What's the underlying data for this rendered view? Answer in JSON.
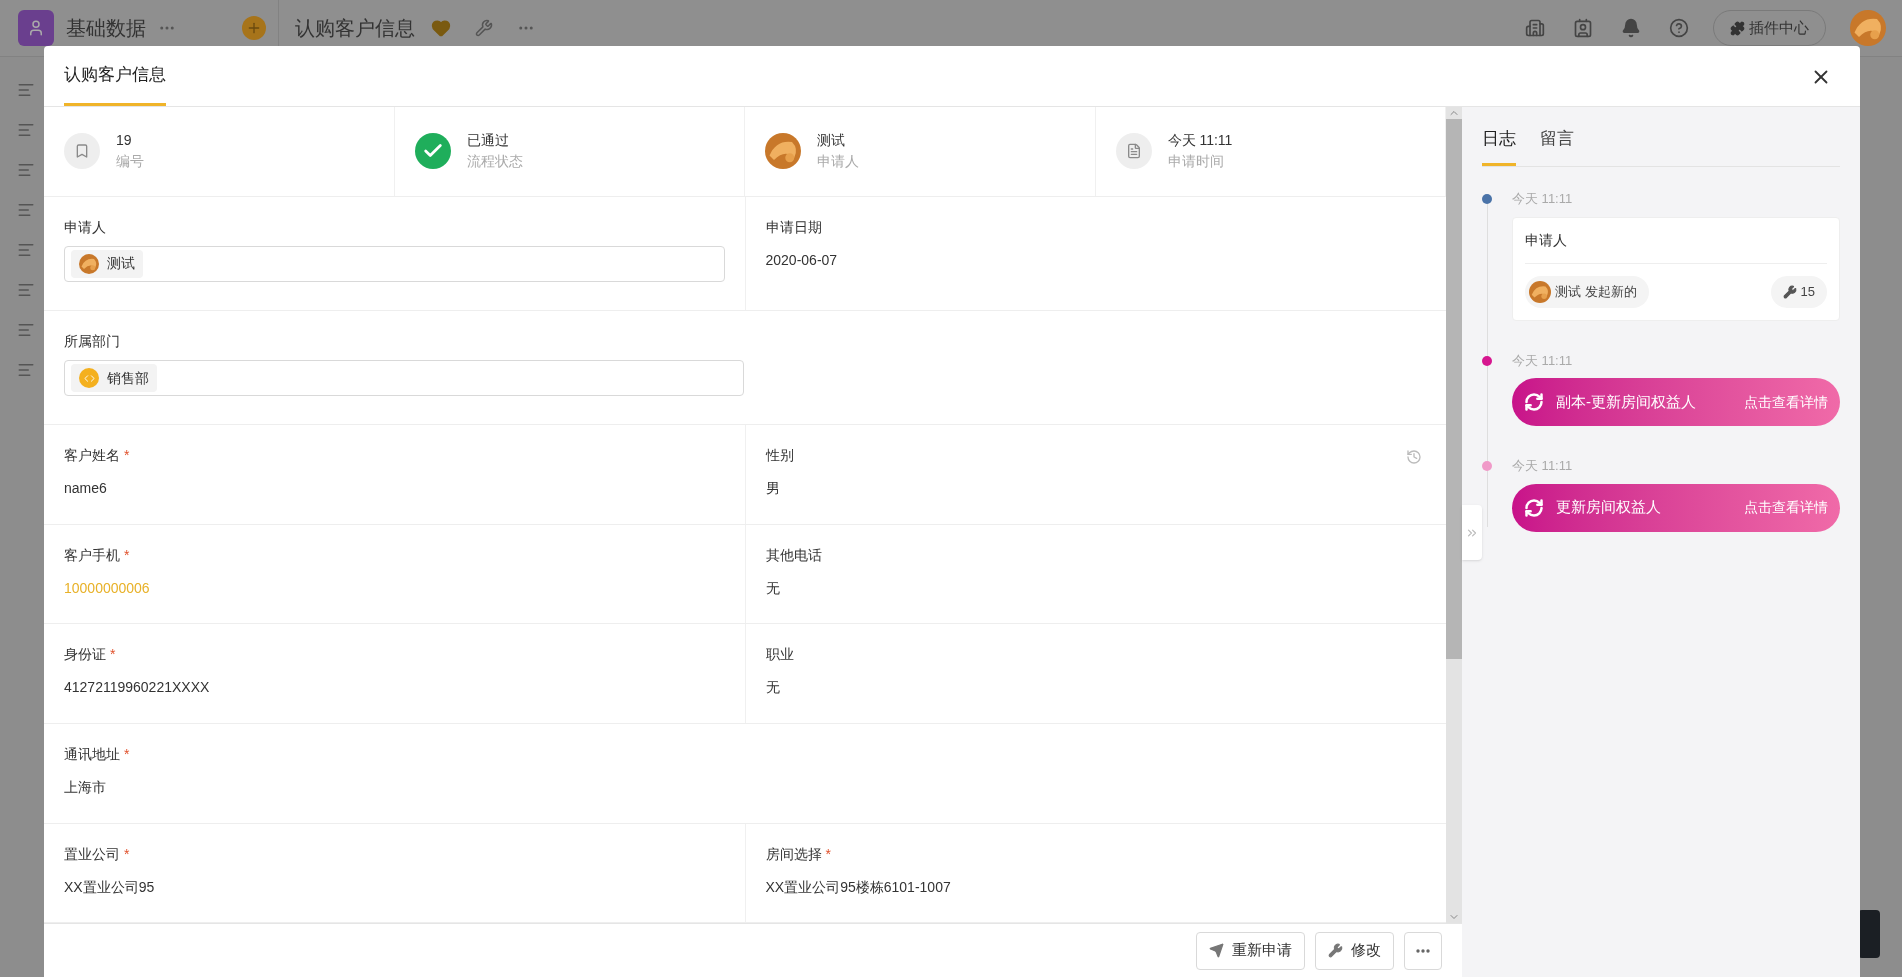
{
  "app_header": {
    "title": "基础数据",
    "page_title": "认购客户信息",
    "plugin_button": "插件中心"
  },
  "dialog": {
    "tabs": [
      {
        "label": "认购客户信息",
        "selected": true
      }
    ],
    "summary": [
      {
        "kind": "number",
        "value": "19",
        "label": "编号"
      },
      {
        "kind": "status",
        "value": "已通过",
        "label": "流程状态"
      },
      {
        "kind": "person",
        "value": "测试",
        "label": "申请人"
      },
      {
        "kind": "time",
        "value": "今天 11:11",
        "label": "申请时间"
      }
    ],
    "rows": [
      [
        {
          "label": "申请人",
          "kind": "user",
          "value": "测试"
        },
        {
          "label": "申请日期",
          "kind": "text",
          "value": "2020-06-07"
        }
      ],
      [
        {
          "label": "所属部门",
          "kind": "dept",
          "value": "销售部"
        }
      ],
      [
        {
          "label": "客户姓名",
          "required_mark": "*",
          "kind": "text",
          "value": "name6"
        },
        {
          "label": "性别",
          "kind": "history",
          "value": "男"
        }
      ],
      [
        {
          "label": "客户手机",
          "required_mark": "*",
          "kind": "phone",
          "value": "10000000006"
        },
        {
          "label": "其他电话",
          "kind": "text",
          "value": "无"
        }
      ],
      [
        {
          "label": "身份证",
          "required_mark": "*",
          "kind": "text",
          "value": "41272119960221XXXX"
        },
        {
          "label": "职业",
          "kind": "text",
          "value": "无"
        }
      ],
      [
        {
          "label": "通讯地址",
          "required_mark": "*",
          "kind": "text",
          "value": "上海市"
        }
      ],
      [
        {
          "label": "置业公司",
          "required_mark": "*",
          "kind": "text",
          "value": "XX置业公司95"
        },
        {
          "label": "房间选择",
          "required_mark": "*",
          "kind": "text",
          "value": "XX置业公司95楼栋6101-1007"
        }
      ]
    ],
    "buttons": [
      {
        "kind": "resubmit",
        "label": "重新申请"
      },
      {
        "kind": "edit",
        "label": "修改"
      },
      {
        "kind": "more"
      }
    ],
    "log": {
      "tabs": [
        {
          "label": "日志",
          "selected": true
        },
        {
          "label": "留言",
          "selected": false
        }
      ],
      "events": [
        {
          "kind": "card",
          "time": "今天 11:11",
          "color": "#4a73a8",
          "title": "申请人",
          "user": "测试",
          "action": "发起新的",
          "count": "15"
        },
        {
          "kind": "pill",
          "time": "今天 11:11",
          "color": "#d6168f",
          "text": "副本-更新房间权益人",
          "link": "点击查看详情"
        },
        {
          "kind": "pill",
          "time": "今天 11:11",
          "color": "#f09ac8",
          "text": "更新房间权益人",
          "link": "点击查看详情"
        }
      ]
    }
  }
}
